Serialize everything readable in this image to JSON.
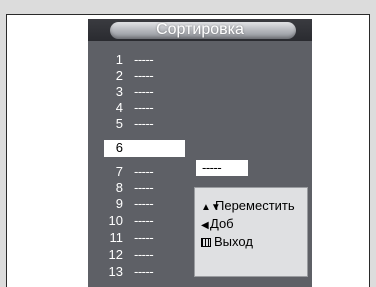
{
  "menu": {
    "title": "Сортировка",
    "rows": [
      {
        "num": "1",
        "value": "-----"
      },
      {
        "num": "2",
        "value": "-----"
      },
      {
        "num": "3",
        "value": "-----"
      },
      {
        "num": "4",
        "value": "-----"
      },
      {
        "num": "5",
        "value": "-----"
      },
      {
        "num": "6",
        "value": ""
      },
      {
        "num": "7",
        "value": "-----"
      },
      {
        "num": "8",
        "value": "-----"
      },
      {
        "num": "9",
        "value": "-----"
      },
      {
        "num": "10",
        "value": "-----"
      },
      {
        "num": "11",
        "value": "-----"
      },
      {
        "num": "12",
        "value": "-----"
      },
      {
        "num": "13",
        "value": "-----"
      }
    ],
    "selected_row": "6",
    "moving_value": "-----"
  },
  "help": {
    "move_icon": "▲▼",
    "move_label": "Переместить",
    "add_icon": "◀",
    "add_label": "Доб",
    "exit_icon": "menu-icon",
    "exit_label": "Выход"
  }
}
